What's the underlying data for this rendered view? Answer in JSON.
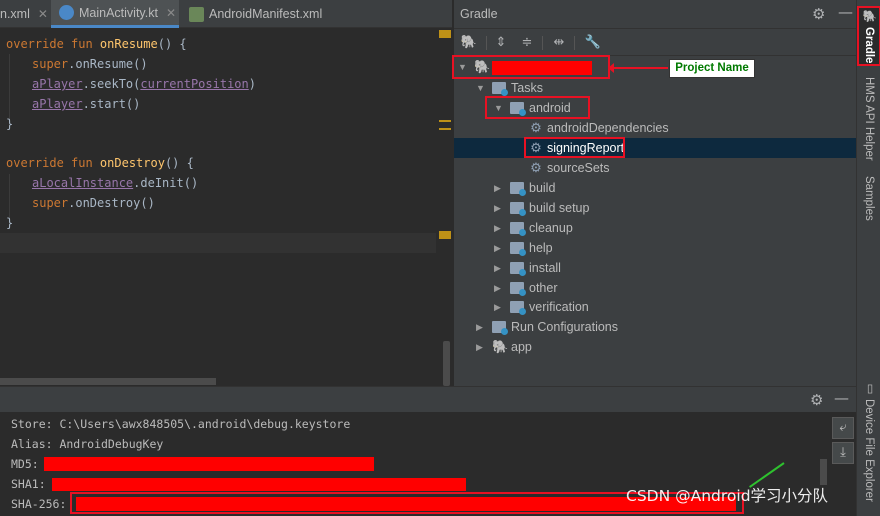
{
  "editor_tabs": [
    {
      "label": "n.xml",
      "icon": "xml-file-icon"
    },
    {
      "label": "MainActivity.kt",
      "icon": "kotlin-file-icon"
    },
    {
      "label": "AndroidManifest.xml",
      "icon": "manifest-file-icon"
    }
  ],
  "code": {
    "line1_kw": "override fun ",
    "line1_fn": "onResume",
    "line1_rest": "() {",
    "line2_super": "super",
    "line2_rest": ".onResume()",
    "line3_var": "aPlayer",
    "line3_mid": ".seekTo(",
    "line3_arg": "currentPosition",
    "line3_end": ")",
    "line4_var": "aPlayer",
    "line4_rest": ".start()",
    "line5": "}",
    "line7_kw": "override fun ",
    "line7_fn": "onDestroy",
    "line7_rest": "() {",
    "line8_var": "aLocalInstance",
    "line8_rest": ".deInit()",
    "line9_super": "super",
    "line9_rest": ".onDestroy()",
    "line10": "}"
  },
  "gradle": {
    "title": "Gradle",
    "callout": "Project Name",
    "tree": {
      "tasks": "Tasks",
      "android": "android",
      "androidDependencies": "androidDependencies",
      "signingReport": "signingReport",
      "sourceSets": "sourceSets",
      "groups": [
        "build",
        "build setup",
        "cleanup",
        "help",
        "install",
        "other",
        "verification"
      ],
      "run_configurations": "Run Configurations",
      "app": "app"
    }
  },
  "right_stripe": {
    "tabs": [
      "Gradle",
      "HMS API Helper",
      "Samples",
      "Device File Explorer"
    ]
  },
  "console": {
    "store": "Store: C:\\Users\\awx848505\\.android\\debug.keystore",
    "alias": "Alias: AndroidDebugKey",
    "md5": "MD5:",
    "sha1": "SHA1:",
    "sha256": "SHA-256:"
  },
  "watermark": "CSDN @Android学习小分队",
  "colors": {
    "redaction": "#ff0000",
    "annotation_red": "#e81123",
    "callout_green": "#007a00",
    "selection": "#0d293e"
  }
}
